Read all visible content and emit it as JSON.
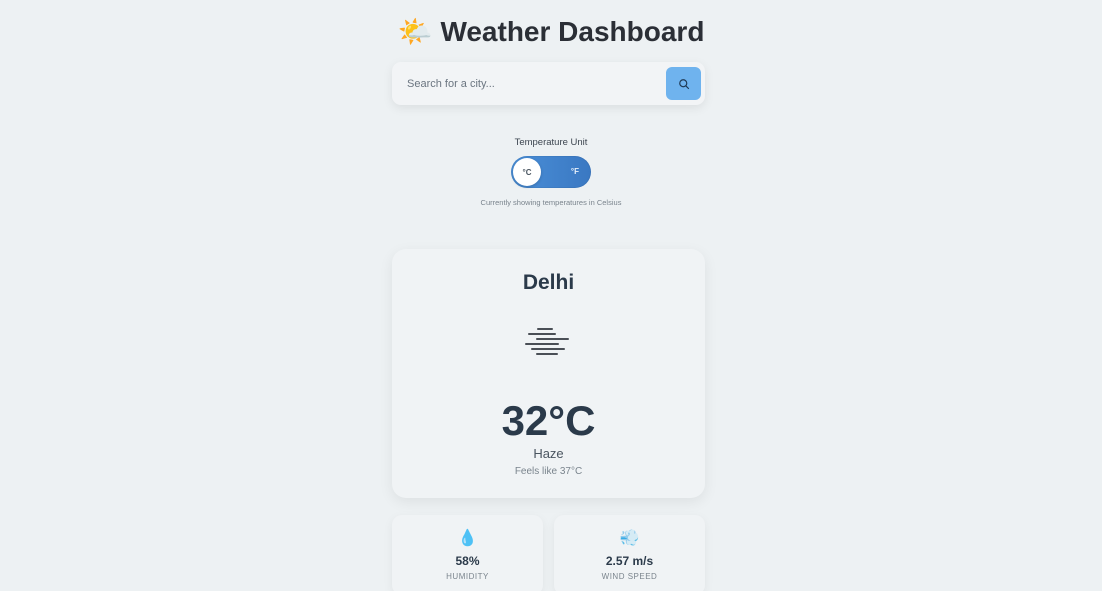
{
  "header": {
    "icon": "sun-behind-cloud-icon",
    "icon_glyph": "🌤️",
    "title": "Weather Dashboard"
  },
  "search": {
    "placeholder": "Search for a city...",
    "value": "",
    "button_icon": "search-icon"
  },
  "unit_toggle": {
    "label": "Temperature Unit",
    "option_c": "°C",
    "option_f": "°F",
    "selected": "°C",
    "caption": "Currently showing temperatures in Celsius"
  },
  "current": {
    "city": "Delhi",
    "icon": "haze-icon",
    "temperature": "32°C",
    "condition": "Haze",
    "feels_like": "Feels like 37°C"
  },
  "stats": [
    {
      "icon": "droplet-icon",
      "glyph": "💧",
      "value": "58%",
      "label": "HUMIDITY"
    },
    {
      "icon": "wind-icon",
      "glyph": "💨",
      "value": "2.57 m/s",
      "label": "WIND SPEED"
    }
  ],
  "colors": {
    "background": "#edf1f3",
    "accent": "#6fb3ee",
    "toggle": "#4a8fd8",
    "text_dark": "#2b3a4a"
  }
}
